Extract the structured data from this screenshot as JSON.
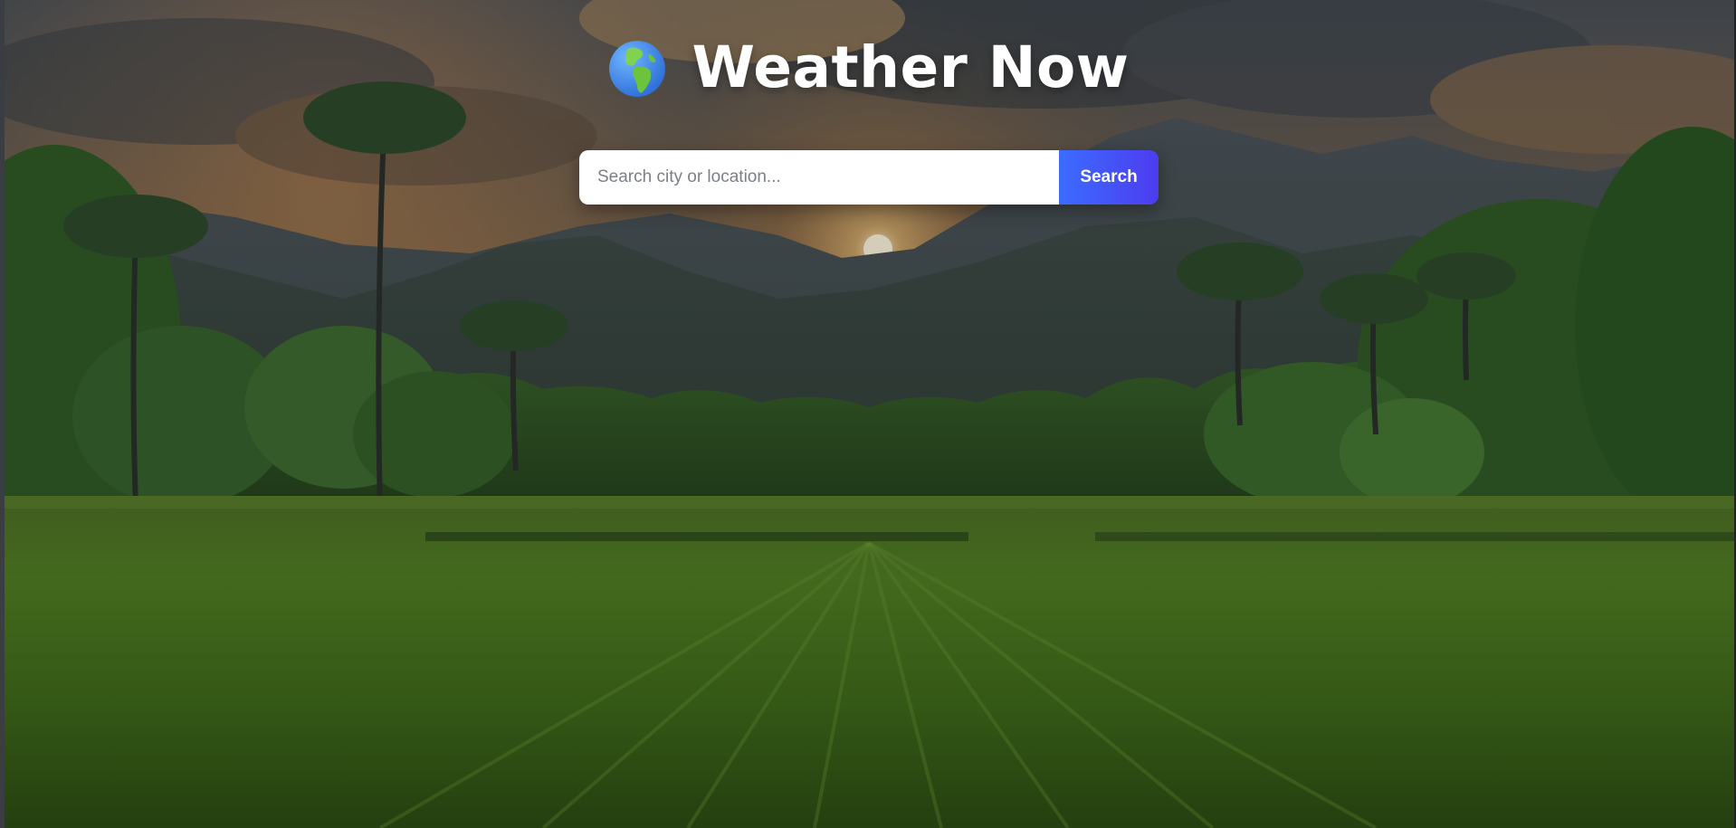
{
  "app": {
    "title": "Weather Now",
    "logo_icon": "globe-europe-africa-icon"
  },
  "search": {
    "placeholder": "Search city or location...",
    "value": "",
    "button_label": "Search"
  },
  "theme": {
    "accent_start": "#3b6cff",
    "accent_end": "#4d3cf0",
    "title_color": "#ffffff"
  },
  "background": {
    "scene": "sunset over mountains with palm trees and green rice field"
  }
}
